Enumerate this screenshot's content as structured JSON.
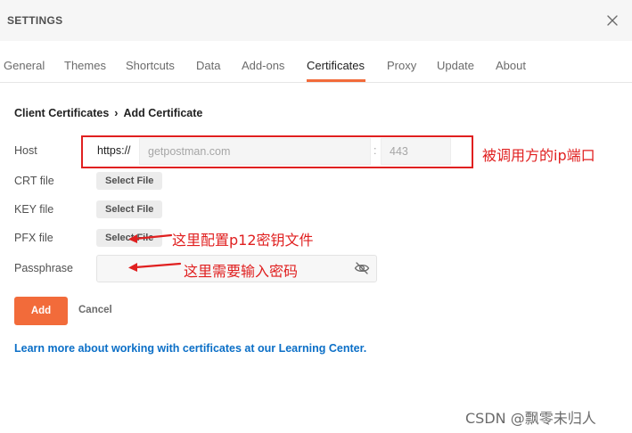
{
  "header": {
    "title": "SETTINGS",
    "close_icon": "close-icon"
  },
  "tabs": [
    {
      "label": "General",
      "active": false
    },
    {
      "label": "Themes",
      "active": false
    },
    {
      "label": "Shortcuts",
      "active": false
    },
    {
      "label": "Data",
      "active": false
    },
    {
      "label": "Add-ons",
      "active": false
    },
    {
      "label": "Certificates",
      "active": true
    },
    {
      "label": "Proxy",
      "active": false
    },
    {
      "label": "Update",
      "active": false
    },
    {
      "label": "About",
      "active": false
    }
  ],
  "breadcrumb": {
    "parent": "Client Certificates",
    "separator": "›",
    "current": "Add Certificate"
  },
  "form": {
    "host": {
      "label": "Host",
      "prefix": "https://",
      "host_placeholder": "getpostman.com",
      "colon": ":",
      "port_placeholder": "443"
    },
    "crt": {
      "label": "CRT file",
      "button": "Select File"
    },
    "key": {
      "label": "KEY file",
      "button": "Select File"
    },
    "pfx": {
      "label": "PFX file",
      "button": "Select File"
    },
    "passphrase": {
      "label": "Passphrase",
      "value": "",
      "icon": "eye-slash-icon"
    }
  },
  "actions": {
    "add": "Add",
    "cancel": "Cancel"
  },
  "learn_more": "Learn more about working with certificates at our Learning Center.",
  "annotations": {
    "host": "被调用方的ip端口",
    "pfx": "这里配置p12密钥文件",
    "passphrase": "这里需要输入密码"
  },
  "watermark": "CSDN @飘零未归人",
  "colors": {
    "accent": "#f26b3a",
    "annotation": "#e02020",
    "link": "#0b6fc7"
  }
}
